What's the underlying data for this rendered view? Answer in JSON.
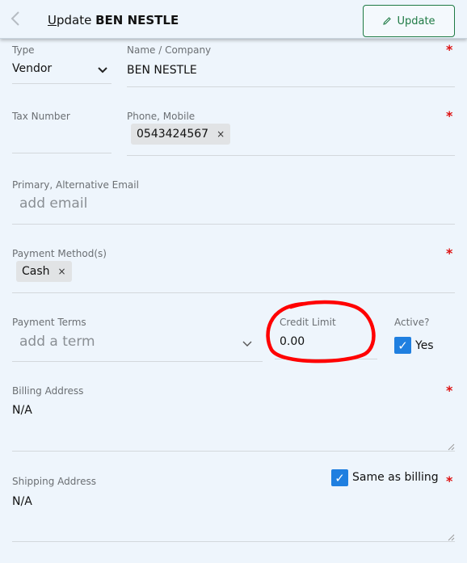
{
  "header": {
    "title_prefix": "U",
    "title_rest": "pdate",
    "title_name": "BEN NESTLE",
    "update_label": "Update",
    "back_icon": "chevron-left-icon",
    "update_icon": "pencil-icon"
  },
  "form": {
    "type": {
      "label": "Type",
      "value": "Vendor"
    },
    "name": {
      "label": "Name / Company",
      "value": "BEN NESTLE"
    },
    "tax": {
      "label": "Tax Number",
      "value": ""
    },
    "phone": {
      "label": "Phone, Mobile",
      "chips": [
        "0543424567"
      ]
    },
    "email": {
      "label": "Primary, Alternative Email",
      "placeholder": "add email"
    },
    "payment_methods": {
      "label": "Payment Method(s)",
      "chips": [
        "Cash"
      ]
    },
    "payment_terms": {
      "label": "Payment Terms",
      "placeholder": "add a term"
    },
    "credit_limit": {
      "label": "Credit Limit",
      "value": "0.00"
    },
    "active": {
      "label": "Active?",
      "option": "Yes",
      "checked": true
    },
    "billing": {
      "label": "Billing Address",
      "value": "N/A"
    },
    "shipping": {
      "label": "Shipping Address",
      "value": "N/A",
      "same_as_billing_label": "Same as billing",
      "same_as_billing": true
    }
  },
  "colors": {
    "background": "#eef5fc",
    "accent_green": "#1e7a44",
    "required_red": "#dd1111",
    "checkbox_blue": "#1f7fe0",
    "annotation_red": "#ff0000"
  }
}
